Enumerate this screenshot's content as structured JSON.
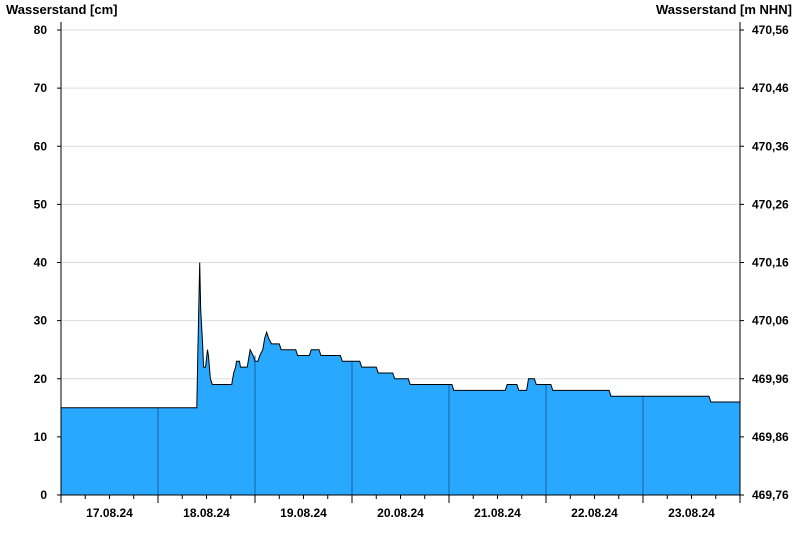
{
  "chart_data": {
    "type": "area",
    "ylabel": "Wasserstand [cm]",
    "ylabel_right": "Wasserstand [m NHN]",
    "ylim": [
      0,
      80
    ],
    "yticks": [
      0,
      10,
      20,
      30,
      40,
      50,
      60,
      70,
      80
    ],
    "yticks_right": [
      "469,76",
      "469,86",
      "469,96",
      "470,06",
      "470,16",
      "470,26",
      "470,36",
      "470,46",
      "470,56"
    ],
    "xlim": [
      0,
      7
    ],
    "x_unit": "days from 17.08.24 00:00",
    "day_labels": [
      "17.08.24",
      "18.08.24",
      "19.08.24",
      "20.08.24",
      "21.08.24",
      "22.08.24",
      "23.08.24"
    ],
    "grid": true,
    "fill_color": "#29a8ff",
    "line_color": "#000000",
    "points": [
      [
        0.0,
        15
      ],
      [
        1.4,
        15
      ],
      [
        1.41,
        24
      ],
      [
        1.42,
        32
      ],
      [
        1.43,
        40
      ],
      [
        1.44,
        32
      ],
      [
        1.46,
        26
      ],
      [
        1.47,
        22
      ],
      [
        1.49,
        22
      ],
      [
        1.51,
        25
      ],
      [
        1.52,
        24
      ],
      [
        1.54,
        20
      ],
      [
        1.56,
        19
      ],
      [
        1.76,
        19
      ],
      [
        1.78,
        21
      ],
      [
        1.8,
        22
      ],
      [
        1.81,
        23
      ],
      [
        1.84,
        23
      ],
      [
        1.85,
        22
      ],
      [
        1.92,
        22
      ],
      [
        1.94,
        24
      ],
      [
        1.95,
        25
      ],
      [
        1.98,
        24
      ],
      [
        2.0,
        23
      ],
      [
        2.03,
        23
      ],
      [
        2.05,
        24
      ],
      [
        2.08,
        25
      ],
      [
        2.1,
        27
      ],
      [
        2.12,
        28
      ],
      [
        2.14,
        27
      ],
      [
        2.17,
        26
      ],
      [
        2.25,
        26
      ],
      [
        2.27,
        25
      ],
      [
        2.42,
        25
      ],
      [
        2.44,
        24
      ],
      [
        2.56,
        24
      ],
      [
        2.58,
        25
      ],
      [
        2.66,
        25
      ],
      [
        2.68,
        24
      ],
      [
        2.88,
        24
      ],
      [
        2.9,
        23
      ],
      [
        3.08,
        23
      ],
      [
        3.1,
        22
      ],
      [
        3.25,
        22
      ],
      [
        3.27,
        21
      ],
      [
        3.42,
        21
      ],
      [
        3.44,
        20
      ],
      [
        3.58,
        20
      ],
      [
        3.6,
        19
      ],
      [
        4.03,
        19
      ],
      [
        4.05,
        18
      ],
      [
        4.58,
        18
      ],
      [
        4.6,
        19
      ],
      [
        4.7,
        19
      ],
      [
        4.72,
        18
      ],
      [
        4.8,
        18
      ],
      [
        4.82,
        20
      ],
      [
        4.88,
        20
      ],
      [
        4.9,
        19
      ],
      [
        5.05,
        19
      ],
      [
        5.07,
        18
      ],
      [
        5.65,
        18
      ],
      [
        5.67,
        17
      ],
      [
        6.68,
        17
      ],
      [
        6.7,
        16
      ],
      [
        7.0,
        16
      ]
    ]
  }
}
